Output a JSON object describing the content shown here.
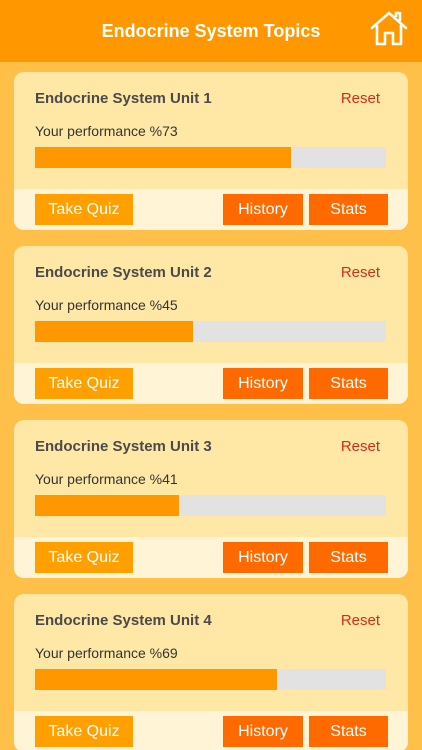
{
  "header": {
    "title": "Endocrine System Topics",
    "home_icon": "house-icon"
  },
  "colors": {
    "header_bg": "#ff9800",
    "page_bg": "#ffc04a",
    "card_bg": "#ffe8a6",
    "bar_fill": "#ff9800",
    "bar_track": "#e2e2e2",
    "quiz_button": "#ffa000",
    "action_button": "#ff6a00",
    "reset_text": "#d42b1c"
  },
  "units": [
    {
      "title": "Endocrine System Unit 1",
      "reset_label": "Reset",
      "performance_text": "Your performance %73",
      "performance_value": 73,
      "quiz_label": "Take Quiz",
      "history_label": "History",
      "stats_label": "Stats"
    },
    {
      "title": "Endocrine System Unit 2",
      "reset_label": "Reset",
      "performance_text": "Your performance %45",
      "performance_value": 45,
      "quiz_label": "Take Quiz",
      "history_label": "History",
      "stats_label": "Stats"
    },
    {
      "title": "Endocrine System Unit 3",
      "reset_label": "Reset",
      "performance_text": "Your performance %41",
      "performance_value": 41,
      "quiz_label": "Take Quiz",
      "history_label": "History",
      "stats_label": "Stats"
    },
    {
      "title": "Endocrine System Unit 4",
      "reset_label": "Reset",
      "performance_text": "Your performance %69",
      "performance_value": 69,
      "quiz_label": "Take Quiz",
      "history_label": "History",
      "stats_label": "Stats"
    }
  ]
}
